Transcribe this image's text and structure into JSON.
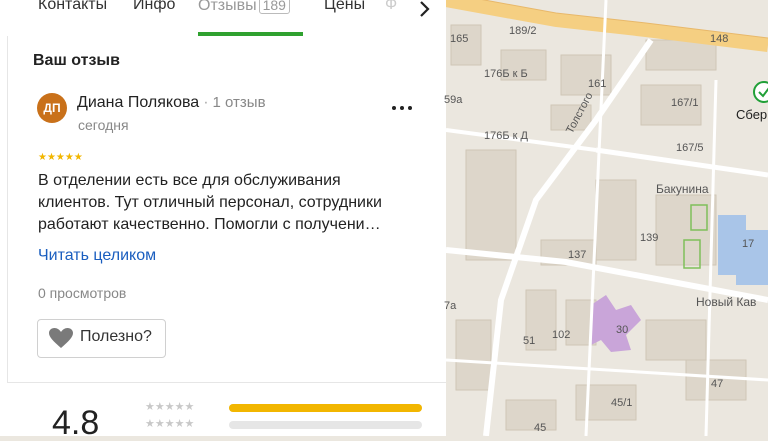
{
  "tabs": [
    {
      "label": "Контакты"
    },
    {
      "label": "Инфо"
    },
    {
      "label": "Отзывы",
      "count": "189"
    },
    {
      "label": "Цены"
    },
    {
      "label": "Ф"
    }
  ],
  "review_section": {
    "heading": "Ваш отзыв",
    "avatar_initials": "ДП",
    "author_name": "Диана Полякова",
    "separator": "·",
    "author_reviews": "1 отзыв",
    "date": "сегодня",
    "stars": "★★★★★",
    "rating_value": 5,
    "text_lines": [
      "В отделении есть все для обслуживания",
      "клиентов. Тут отличный персонал, сотрудники",
      "работают качественно. Помогли с получени…"
    ],
    "read_more": "Читать целиком",
    "views": "0 просмотров",
    "useful_label": "Полезно?"
  },
  "rating_summary": {
    "value": "4.8",
    "distribution": [
      {
        "stars": "★★★★★",
        "fraction": 1.0
      },
      {
        "stars": "★★★★★",
        "fraction": 0.0
      }
    ]
  },
  "map": {
    "labels": [
      "165",
      "189/2",
      "148",
      "176Б к Б",
      "161",
      "59а",
      "167/1",
      "176Б к Д",
      "167/5",
      "Толстого",
      "Бакунина",
      "139",
      "137",
      "17",
      "Новый Кав",
      "7а",
      "30",
      "102",
      "51",
      "47",
      "45/1",
      "45",
      "Сбер"
    ],
    "colors": {
      "road_major": "#f5cf82",
      "road": "#ffffff",
      "building": "#d9d2c5",
      "green": "#7fbf5a",
      "purple": "#c9a5d9",
      "blue": "#a9c5e8"
    }
  },
  "colors": {
    "accent": "#2fa12f",
    "link": "#1a5ebf",
    "star": "#f2b600",
    "avatar": "#c9711a"
  }
}
